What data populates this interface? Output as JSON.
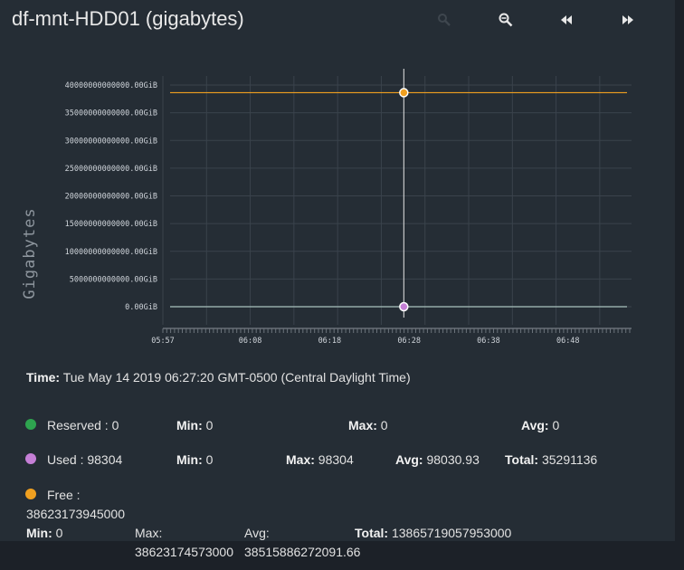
{
  "title": "df-mnt-HDD01 (gigabytes)",
  "toolbar": {
    "zoom_in_icon": "zoom-in-icon",
    "zoom_out_icon": "zoom-out-icon",
    "rewind_icon": "rewind-icon",
    "forward_icon": "fast-forward-icon"
  },
  "colors": {
    "reserved": "#2ea44f",
    "used": "#c57fd6",
    "free": "#f0a020",
    "grid": "#3a434c",
    "background": "#252d35"
  },
  "chart_data": {
    "type": "line",
    "ylabel": "Gigabytes",
    "ylim": [
      0,
      40000000000000
    ],
    "yticks": [
      {
        "value": 40000000000000,
        "label": "40000000000000.00GiB"
      },
      {
        "value": 35000000000000,
        "label": "35000000000000.00GiB"
      },
      {
        "value": 30000000000000,
        "label": "30000000000000.00GiB"
      },
      {
        "value": 25000000000000,
        "label": "25000000000000.00GiB"
      },
      {
        "value": 20000000000000,
        "label": "20000000000000.00GiB"
      },
      {
        "value": 15000000000000,
        "label": "15000000000000.00GiB"
      },
      {
        "value": 10000000000000,
        "label": "10000000000000.00GiB"
      },
      {
        "value": 5000000000000,
        "label": "5000000000000.00GiB"
      },
      {
        "value": 0,
        "label": "0.00GiB"
      }
    ],
    "xlim": [
      "05:57",
      "06:56"
    ],
    "xticks": [
      "05:57",
      "06:08",
      "06:18",
      "06:28",
      "06:38",
      "06:48"
    ],
    "cursor_time": "06:27:20",
    "series": [
      {
        "name": "Reserved",
        "value": 0,
        "color": "#2ea44f"
      },
      {
        "name": "Used",
        "value": 98304,
        "color": "#c57fd6"
      },
      {
        "name": "Free",
        "value": 38623173945000,
        "color": "#f0a020"
      }
    ]
  },
  "time_info": {
    "label": "Time:",
    "value": "Tue May 14 2019 06:27:20 GMT-0500 (Central Daylight Time)"
  },
  "legend": {
    "reserved": {
      "name": "Reserved : 0",
      "min_label": "Min:",
      "min": "0",
      "max_label": "Max:",
      "max": "0",
      "avg_label": "Avg:",
      "avg": "0"
    },
    "used": {
      "name": "Used : 98304",
      "min_label": "Min:",
      "min": "0",
      "max_label": "Max:",
      "max": "98304",
      "avg_label": "Avg:",
      "avg": "98030.93",
      "total_label": "Total:",
      "total": "35291136"
    },
    "free": {
      "name": "Free :",
      "value": "38623173945000",
      "min_label": "Min:",
      "min": "0",
      "max_label": "Max:",
      "max": "38623174573000",
      "avg_label": "Avg:",
      "avg": "38515886272091.66",
      "total_label": "Total:",
      "total": "13865719057953000"
    }
  }
}
